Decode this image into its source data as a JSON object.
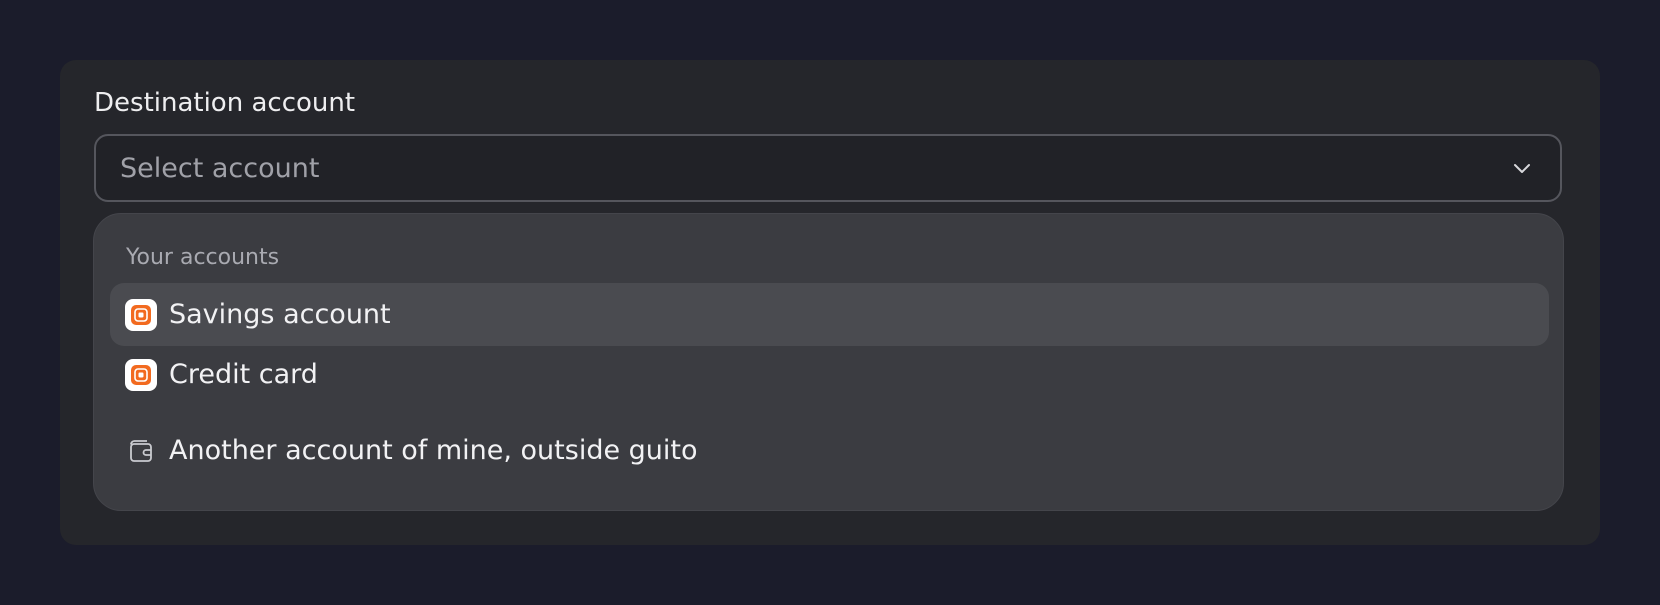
{
  "field": {
    "label": "Destination account",
    "placeholder": "Select account"
  },
  "dropdown": {
    "group_label": "Your accounts",
    "options": [
      {
        "label": "Savings account",
        "icon": "bank-logo-icon",
        "highlighted": true
      },
      {
        "label": "Credit card",
        "icon": "bank-logo-icon",
        "highlighted": false
      }
    ],
    "external_option": {
      "label": "Another account of mine, outside guito",
      "icon": "wallet-icon"
    }
  },
  "colors": {
    "page_background": "#1b1c2b",
    "card_background": "#25262b",
    "dropdown_background": "#3b3c41",
    "highlight_background": "#4a4b50",
    "brand_orange": "#f26a1f"
  }
}
